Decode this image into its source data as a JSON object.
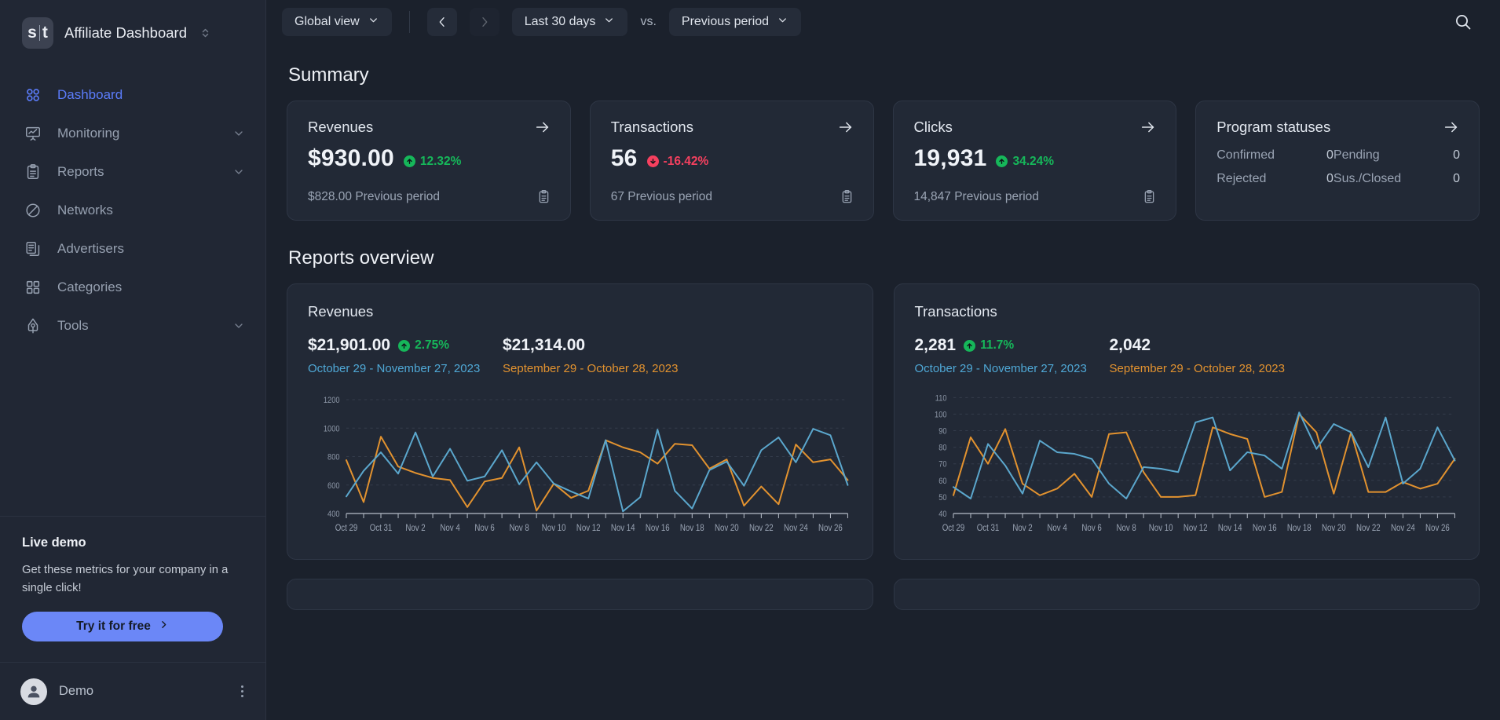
{
  "sidebar": {
    "logo_text": "s|t",
    "brand_title": "Affiliate Dashboard",
    "items": [
      {
        "label": "Dashboard",
        "icon": "grid-circles-icon",
        "active": true,
        "expandable": false
      },
      {
        "label": "Monitoring",
        "icon": "presentation-chart-icon",
        "active": false,
        "expandable": true
      },
      {
        "label": "Reports",
        "icon": "clipboard-icon",
        "active": false,
        "expandable": true
      },
      {
        "label": "Networks",
        "icon": "pie-slice-icon",
        "active": false,
        "expandable": false
      },
      {
        "label": "Advertisers",
        "icon": "documents-icon",
        "active": false,
        "expandable": false
      },
      {
        "label": "Categories",
        "icon": "grid-squares-icon",
        "active": false,
        "expandable": false
      },
      {
        "label": "Tools",
        "icon": "pen-nib-icon",
        "active": false,
        "expandable": true
      }
    ],
    "promo": {
      "title": "Live demo",
      "text": "Get these metrics for your company in a single click!",
      "button_label": "Try it for free"
    },
    "user": {
      "name": "Demo",
      "avatar_icon": "user-avatar-icon",
      "menu_icon": "kebab-menu-icon"
    }
  },
  "topbar": {
    "view_selector": "Global view",
    "prev_label": "‹",
    "next_label": "›",
    "date_range": "Last 30 days",
    "vs_label": "vs.",
    "compare_range": "Previous period",
    "search_icon": "search-icon"
  },
  "summary": {
    "title": "Summary",
    "cards": [
      {
        "title": "Revenues",
        "value": "$930.00",
        "delta": "12.32%",
        "delta_direction": "up",
        "previous": "$828.00 Previous period",
        "arrow_icon": "arrow-right-icon",
        "copy_icon": "clipboard-copy-icon"
      },
      {
        "title": "Transactions",
        "value": "56",
        "delta": "-16.42%",
        "delta_direction": "down",
        "previous": "67 Previous period",
        "arrow_icon": "arrow-right-icon",
        "copy_icon": "clipboard-copy-icon"
      },
      {
        "title": "Clicks",
        "value": "19,931",
        "delta": "34.24%",
        "delta_direction": "up",
        "previous": "14,847 Previous period",
        "arrow_icon": "arrow-right-icon",
        "copy_icon": "clipboard-copy-icon"
      }
    ],
    "program_statuses": {
      "title": "Program statuses",
      "arrow_icon": "arrow-right-icon",
      "rows": [
        {
          "label": "Confirmed",
          "value": "0",
          "label2": "Pending",
          "value2": "0"
        },
        {
          "label": "Rejected",
          "value": "0",
          "label2": "Sus./Closed",
          "value2": "0"
        }
      ]
    }
  },
  "reports": {
    "title": "Reports overview"
  },
  "colors": {
    "accent_blue": "#5b7cfa",
    "series_current": "#5ba7cd",
    "series_previous": "#e2922f",
    "positive": "#16b75a",
    "negative": "#f6405f",
    "card_bg": "#222936",
    "page_bg": "#1b212c",
    "sidebar_bg": "#212734"
  },
  "chart_data": [
    {
      "type": "line",
      "title": "Revenues",
      "stat_current": "$21,901.00",
      "stat_delta": "2.75%",
      "stat_delta_direction": "up",
      "stat_previous": "$21,314.00",
      "range_current": "October 29 - November 27, 2023",
      "range_previous": "September 29 - October 28, 2023",
      "xlabel": "",
      "ylabel": "",
      "ylim": [
        400,
        1250
      ],
      "yticks": [
        400,
        600,
        800,
        1000,
        1200
      ],
      "grid": true,
      "legend": "none",
      "x": [
        "Oct 29",
        "Oct 30",
        "Oct 31",
        "Nov 1",
        "Nov 2",
        "Nov 3",
        "Nov 4",
        "Nov 5",
        "Nov 6",
        "Nov 7",
        "Nov 8",
        "Nov 9",
        "Nov 10",
        "Nov 11",
        "Nov 12",
        "Nov 13",
        "Nov 14",
        "Nov 15",
        "Nov 16",
        "Nov 17",
        "Nov 18",
        "Nov 19",
        "Nov 20",
        "Nov 21",
        "Nov 22",
        "Nov 23",
        "Nov 24",
        "Nov 25",
        "Nov 26",
        "Nov 27"
      ],
      "xticklabels": [
        "Oct 29",
        "Oct 31",
        "Nov 2",
        "Nov 4",
        "Nov 6",
        "Nov 8",
        "Nov 10",
        "Nov 12",
        "Nov 14",
        "Nov 16",
        "Nov 18",
        "Nov 20",
        "Nov 22",
        "Nov 24",
        "Nov 26"
      ],
      "series": [
        {
          "name": "October 29 - November 27, 2023",
          "color": "#5ba7cd",
          "values": [
            520,
            700,
            830,
            680,
            970,
            660,
            855,
            630,
            660,
            845,
            605,
            760,
            610,
            555,
            505,
            915,
            415,
            515,
            990,
            560,
            435,
            705,
            765,
            595,
            845,
            935,
            760,
            995,
            950,
            600
          ]
        },
        {
          "name": "September 29 - October 28, 2023",
          "color": "#e2922f",
          "values": [
            775,
            480,
            940,
            730,
            685,
            650,
            635,
            445,
            625,
            650,
            865,
            420,
            610,
            510,
            560,
            915,
            865,
            830,
            750,
            890,
            880,
            715,
            780,
            455,
            590,
            465,
            885,
            760,
            780,
            635
          ]
        }
      ]
    },
    {
      "type": "line",
      "title": "Transactions",
      "stat_current": "2,281",
      "stat_delta": "11.7%",
      "stat_delta_direction": "up",
      "stat_previous": "2,042",
      "range_current": "October 29 - November 27, 2023",
      "range_previous": "September 29 - October 28, 2023",
      "xlabel": "",
      "ylabel": "",
      "ylim": [
        40,
        113
      ],
      "yticks": [
        40,
        50,
        60,
        70,
        80,
        90,
        100,
        110
      ],
      "grid": true,
      "legend": "none",
      "x": [
        "Oct 29",
        "Oct 30",
        "Oct 31",
        "Nov 1",
        "Nov 2",
        "Nov 3",
        "Nov 4",
        "Nov 5",
        "Nov 6",
        "Nov 7",
        "Nov 8",
        "Nov 9",
        "Nov 10",
        "Nov 11",
        "Nov 12",
        "Nov 13",
        "Nov 14",
        "Nov 15",
        "Nov 16",
        "Nov 17",
        "Nov 18",
        "Nov 19",
        "Nov 20",
        "Nov 21",
        "Nov 22",
        "Nov 23",
        "Nov 24",
        "Nov 25",
        "Nov 26",
        "Nov 27"
      ],
      "xticklabels": [
        "Oct 29",
        "Oct 31",
        "Nov 2",
        "Nov 4",
        "Nov 6",
        "Nov 8",
        "Nov 10",
        "Nov 12",
        "Nov 14",
        "Nov 16",
        "Nov 18",
        "Nov 20",
        "Nov 22",
        "Nov 24",
        "Nov 26"
      ],
      "series": [
        {
          "name": "October 29 - November 27, 2023",
          "color": "#5ba7cd",
          "values": [
            56,
            49,
            82,
            69,
            52,
            84,
            77,
            76,
            73,
            58,
            49,
            68,
            67,
            65,
            95,
            98,
            66,
            77,
            75,
            67,
            101,
            79,
            94,
            89,
            68,
            98,
            58,
            67,
            92,
            72
          ]
        },
        {
          "name": "September 29 - October 28, 2023",
          "color": "#e2922f",
          "values": [
            51,
            86,
            70,
            91,
            58,
            51,
            55,
            64,
            50,
            88,
            89,
            65,
            50,
            50,
            51,
            92,
            88,
            85,
            50,
            53,
            100,
            89,
            52,
            89,
            53,
            53,
            59,
            55,
            58,
            73
          ]
        }
      ]
    }
  ]
}
